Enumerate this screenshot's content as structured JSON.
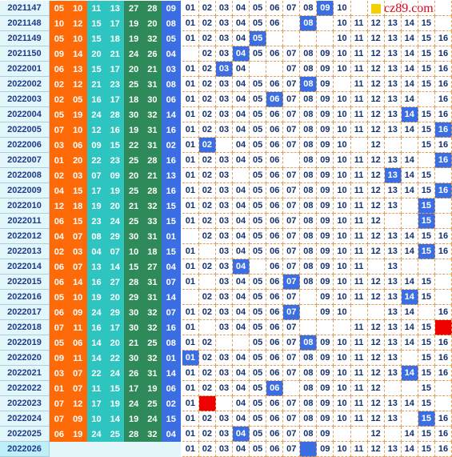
{
  "logo": {
    "text": "cz89.com",
    "square_color": "#f5d000",
    "text_color": "#e0001b"
  },
  "colors": {
    "front_a": "#ff6a08",
    "front_b": "#2ec5c0",
    "front_c": "#2e8a58",
    "back": "#3a6ee2",
    "issue_bg": "#e3f7fb",
    "issue_text": "#1d3a8c",
    "digit_text": "#15306e",
    "highlight": "#3a6ee2",
    "marker_red": "#ee0000"
  },
  "digit_labels": [
    "01",
    "02",
    "03",
    "04",
    "05",
    "06",
    "07",
    "08",
    "09",
    "10",
    "11",
    "12",
    "13",
    "14",
    "15",
    "16"
  ],
  "rows": [
    {
      "issue": "2021147",
      "red": [
        "05",
        "10",
        "11",
        "13",
        "27",
        "28"
      ],
      "blue": "09",
      "shown": [
        1,
        2,
        3,
        4,
        5,
        6,
        7,
        8,
        9,
        10
      ],
      "hl": [
        9
      ],
      "redbox": []
    },
    {
      "issue": "2021148",
      "red": [
        "10",
        "12",
        "15",
        "17",
        "19",
        "20"
      ],
      "blue": "08",
      "shown": [
        1,
        2,
        3,
        4,
        5,
        6,
        8,
        10,
        11,
        12,
        13,
        14,
        15
      ],
      "hl": [
        8
      ],
      "redbox": []
    },
    {
      "issue": "2021149",
      "red": [
        "05",
        "10",
        "15",
        "18",
        "19",
        "32"
      ],
      "blue": "05",
      "shown": [
        1,
        2,
        3,
        4,
        5,
        10,
        11,
        12,
        13,
        14,
        15,
        16
      ],
      "hl": [
        5
      ],
      "redbox": []
    },
    {
      "issue": "2021150",
      "red": [
        "09",
        "14",
        "20",
        "21",
        "24",
        "26"
      ],
      "blue": "04",
      "shown": [
        2,
        3,
        4,
        5,
        6,
        7,
        8,
        9,
        10,
        11,
        12,
        13,
        14,
        15,
        16
      ],
      "hl": [
        4
      ],
      "redbox": []
    },
    {
      "issue": "2022001",
      "red": [
        "06",
        "13",
        "15",
        "17",
        "20",
        "21"
      ],
      "blue": "03",
      "shown": [
        1,
        2,
        3,
        4,
        7,
        8,
        9,
        10,
        11,
        12,
        13,
        14,
        15,
        16
      ],
      "hl": [
        3
      ],
      "redbox": []
    },
    {
      "issue": "2022002",
      "red": [
        "02",
        "12",
        "21",
        "23",
        "25",
        "31"
      ],
      "blue": "08",
      "shown": [
        1,
        2,
        3,
        4,
        5,
        6,
        7,
        8,
        9,
        11,
        12,
        13,
        14,
        15,
        16
      ],
      "hl": [
        8
      ],
      "redbox": []
    },
    {
      "issue": "2022003",
      "red": [
        "02",
        "05",
        "16",
        "17",
        "18",
        "30"
      ],
      "blue": "06",
      "shown": [
        1,
        2,
        3,
        4,
        5,
        6,
        7,
        8,
        9,
        10,
        11,
        12,
        13,
        14,
        16
      ],
      "hl": [
        6
      ],
      "redbox": []
    },
    {
      "issue": "2022004",
      "red": [
        "05",
        "19",
        "24",
        "28",
        "30",
        "32"
      ],
      "blue": "14",
      "shown": [
        1,
        2,
        3,
        4,
        5,
        6,
        7,
        8,
        9,
        10,
        11,
        12,
        13,
        14,
        15,
        16
      ],
      "hl": [
        14
      ],
      "redbox": []
    },
    {
      "issue": "2022005",
      "red": [
        "07",
        "10",
        "12",
        "16",
        "19",
        "31"
      ],
      "blue": "16",
      "shown": [
        1,
        2,
        3,
        4,
        5,
        6,
        7,
        8,
        9,
        10,
        11,
        12,
        13,
        14,
        15,
        16
      ],
      "hl": [
        16
      ],
      "redbox": []
    },
    {
      "issue": "2022006",
      "red": [
        "03",
        "06",
        "09",
        "15",
        "22",
        "31"
      ],
      "blue": "02",
      "shown": [
        1,
        2,
        4,
        5,
        6,
        7,
        8,
        9,
        10,
        12,
        15,
        16
      ],
      "hl": [
        2
      ],
      "redbox": []
    },
    {
      "issue": "2022007",
      "red": [
        "01",
        "20",
        "22",
        "23",
        "25",
        "28"
      ],
      "blue": "16",
      "shown": [
        1,
        2,
        3,
        4,
        5,
        6,
        8,
        9,
        10,
        11,
        12,
        13,
        14,
        16
      ],
      "hl": [
        16
      ],
      "redbox": []
    },
    {
      "issue": "2022008",
      "red": [
        "02",
        "03",
        "07",
        "09",
        "20",
        "21"
      ],
      "blue": "13",
      "shown": [
        1,
        2,
        3,
        5,
        6,
        7,
        8,
        9,
        10,
        11,
        12,
        13,
        14,
        15
      ],
      "hl": [
        13
      ],
      "redbox": []
    },
    {
      "issue": "2022009",
      "red": [
        "04",
        "15",
        "17",
        "19",
        "25",
        "28"
      ],
      "blue": "16",
      "shown": [
        1,
        2,
        3,
        4,
        5,
        6,
        7,
        8,
        9,
        10,
        11,
        12,
        13,
        14,
        15,
        16
      ],
      "hl": [
        16
      ],
      "redbox": []
    },
    {
      "issue": "2022010",
      "red": [
        "12",
        "18",
        "19",
        "20",
        "21",
        "32"
      ],
      "blue": "15",
      "shown": [
        1,
        2,
        3,
        4,
        5,
        6,
        7,
        8,
        9,
        10,
        11,
        12,
        13,
        15
      ],
      "hl": [
        15
      ],
      "redbox": []
    },
    {
      "issue": "2022011",
      "red": [
        "06",
        "15",
        "23",
        "24",
        "25",
        "33"
      ],
      "blue": "15",
      "shown": [
        1,
        2,
        3,
        4,
        5,
        6,
        7,
        8,
        9,
        10,
        11,
        12,
        15
      ],
      "hl": [
        15
      ],
      "redbox": []
    },
    {
      "issue": "2022012",
      "red": [
        "04",
        "07",
        "08",
        "29",
        "30",
        "31"
      ],
      "blue": "01",
      "shown": [
        2,
        3,
        4,
        5,
        6,
        7,
        8,
        9,
        10,
        11,
        12,
        13,
        14,
        15,
        16
      ],
      "hl": [],
      "redbox": []
    },
    {
      "issue": "2022013",
      "red": [
        "02",
        "03",
        "04",
        "07",
        "10",
        "18"
      ],
      "blue": "15",
      "shown": [
        1,
        3,
        4,
        5,
        6,
        7,
        8,
        9,
        10,
        11,
        12,
        13,
        14,
        15,
        16
      ],
      "hl": [
        15
      ],
      "redbox": []
    },
    {
      "issue": "2022014",
      "red": [
        "06",
        "07",
        "13",
        "14",
        "15",
        "27"
      ],
      "blue": "04",
      "shown": [
        1,
        2,
        3,
        4,
        6,
        7,
        8,
        9,
        10,
        11,
        13
      ],
      "hl": [
        4
      ],
      "redbox": []
    },
    {
      "issue": "2022015",
      "red": [
        "06",
        "14",
        "16",
        "27",
        "28",
        "31"
      ],
      "blue": "07",
      "shown": [
        1,
        3,
        4,
        5,
        6,
        7,
        8,
        9,
        10,
        11,
        12,
        13,
        14,
        15
      ],
      "hl": [
        7
      ],
      "redbox": []
    },
    {
      "issue": "2022016",
      "red": [
        "05",
        "10",
        "19",
        "20",
        "29",
        "31"
      ],
      "blue": "14",
      "shown": [
        2,
        3,
        4,
        5,
        6,
        7,
        9,
        10,
        11,
        12,
        13,
        14,
        15
      ],
      "hl": [
        14
      ],
      "redbox": []
    },
    {
      "issue": "2022017",
      "red": [
        "06",
        "09",
        "24",
        "29",
        "30",
        "32"
      ],
      "blue": "07",
      "shown": [
        1,
        2,
        3,
        4,
        5,
        6,
        7,
        9,
        10,
        13,
        14,
        16
      ],
      "hl": [
        7
      ],
      "redbox": []
    },
    {
      "issue": "2022018",
      "red": [
        "07",
        "11",
        "16",
        "17",
        "30",
        "32"
      ],
      "blue": "16",
      "shown": [
        1,
        3,
        4,
        5,
        6,
        7,
        11,
        12,
        13,
        14,
        15
      ],
      "hl": [],
      "redbox": [
        16
      ]
    },
    {
      "issue": "2022019",
      "red": [
        "05",
        "06",
        "14",
        "20",
        "21",
        "25"
      ],
      "blue": "08",
      "shown": [
        1,
        2,
        5,
        6,
        7,
        8,
        9,
        10,
        11,
        12,
        13,
        14,
        15,
        16
      ],
      "hl": [
        8
      ],
      "redbox": []
    },
    {
      "issue": "2022020",
      "red": [
        "09",
        "11",
        "14",
        "22",
        "30",
        "32"
      ],
      "blue": "01",
      "shown": [
        1,
        2,
        3,
        4,
        5,
        6,
        7,
        8,
        9,
        10,
        11,
        12,
        13,
        15,
        16
      ],
      "hl": [
        1
      ],
      "redbox": []
    },
    {
      "issue": "2022021",
      "red": [
        "03",
        "07",
        "22",
        "24",
        "26",
        "31"
      ],
      "blue": "14",
      "shown": [
        1,
        2,
        3,
        4,
        5,
        6,
        7,
        8,
        9,
        10,
        11,
        12,
        13,
        14,
        15,
        16
      ],
      "hl": [
        14
      ],
      "redbox": []
    },
    {
      "issue": "2022022",
      "red": [
        "01",
        "07",
        "11",
        "15",
        "17",
        "19"
      ],
      "blue": "06",
      "shown": [
        1,
        2,
        3,
        4,
        5,
        6,
        8,
        9,
        10,
        11,
        12,
        15
      ],
      "hl": [
        6
      ],
      "redbox": []
    },
    {
      "issue": "2022023",
      "red": [
        "07",
        "12",
        "17",
        "19",
        "24",
        "25"
      ],
      "blue": "02",
      "shown": [
        1,
        4,
        5,
        6,
        7,
        8,
        9,
        10,
        11,
        12,
        13,
        14,
        15
      ],
      "hl": [],
      "redbox": [
        2
      ]
    },
    {
      "issue": "2022024",
      "red": [
        "07",
        "09",
        "10",
        "14",
        "19",
        "24"
      ],
      "blue": "15",
      "shown": [
        1,
        2,
        3,
        4,
        5,
        6,
        7,
        8,
        9,
        10,
        11,
        12,
        13,
        15,
        16
      ],
      "hl": [
        15
      ],
      "redbox": []
    },
    {
      "issue": "2022025",
      "red": [
        "06",
        "19",
        "24",
        "25",
        "28",
        "32"
      ],
      "blue": "04",
      "shown": [
        1,
        2,
        3,
        4,
        5,
        6,
        7,
        8,
        9,
        12,
        14,
        15,
        16
      ],
      "hl": [
        4
      ],
      "redbox": []
    },
    {
      "issue": "2022026",
      "red": [],
      "blue": "",
      "shown": [
        1,
        2,
        3,
        4,
        5,
        6,
        7,
        9,
        10,
        11,
        12,
        13,
        14,
        15,
        16
      ],
      "hl": [
        8
      ],
      "redbox": [],
      "last": true
    }
  ]
}
